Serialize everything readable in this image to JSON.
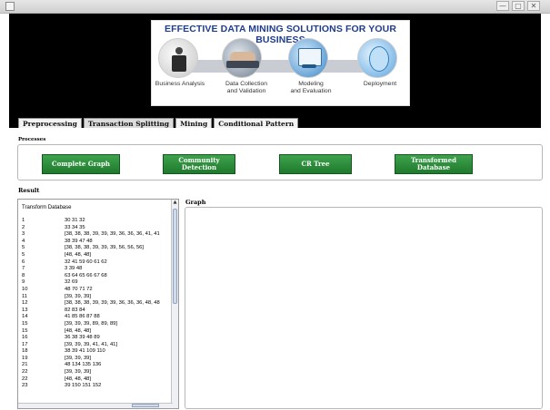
{
  "window": {
    "minimize_icon": "minimize-icon",
    "maximize_icon": "maximize-icon",
    "close_icon": "close-icon",
    "minimize_glyph": "—",
    "maximize_glyph": "▢",
    "close_glyph": "✕"
  },
  "banner": {
    "title": "EFFECTIVE DATA MINING SOLUTIONS FOR YOUR BUSINESS",
    "stages": [
      {
        "line1": "Business Analysis",
        "line2": ""
      },
      {
        "line1": "Data Collection",
        "line2": "and Validation"
      },
      {
        "line1": "Modeling",
        "line2": "and Evaluation"
      },
      {
        "line1": "Deployment",
        "line2": ""
      }
    ]
  },
  "tabs": [
    {
      "label": "Preprocessing",
      "active": false
    },
    {
      "label": "Transaction Splitting",
      "active": true
    },
    {
      "label": "Mining",
      "active": false
    },
    {
      "label": "Conditional Pattern",
      "active": false
    }
  ],
  "processes": {
    "label": "Processes",
    "buttons": [
      {
        "line1": "Complete Graph",
        "line2": ""
      },
      {
        "line1": "Community",
        "line2": "Detection"
      },
      {
        "line1": "CR Tree",
        "line2": ""
      },
      {
        "line1": "Transformed",
        "line2": "Database"
      }
    ],
    "button_color": "#2e8f3c"
  },
  "result": {
    "label": "Result",
    "list_title": "Transform Database",
    "rows": [
      {
        "n": "1",
        "v": "30 31 32"
      },
      {
        "n": "2",
        "v": "33 34 35"
      },
      {
        "n": "3",
        "v": "[38, 38, 38, 39, 39, 39, 36, 36, 36, 41, 41"
      },
      {
        "n": "4",
        "v": "38 39 47 48"
      },
      {
        "n": "5",
        "v": "[38, 38, 38, 39, 39, 39, 56, 56, 56]"
      },
      {
        "n": "5",
        "v": "[48, 48, 48]"
      },
      {
        "n": "6",
        "v": "32 41 59 60 61 62"
      },
      {
        "n": "7",
        "v": "3 39 48"
      },
      {
        "n": "8",
        "v": "63 64 65 66 67 68"
      },
      {
        "n": "9",
        "v": "32 69"
      },
      {
        "n": "10",
        "v": "48 70 71 72"
      },
      {
        "n": "11",
        "v": "[39, 39, 39]"
      },
      {
        "n": "12",
        "v": "[38, 38, 38, 39, 39, 39, 36, 36, 36, 48, 48"
      },
      {
        "n": "13",
        "v": "82 83 84"
      },
      {
        "n": "14",
        "v": "41 85 86 87 88"
      },
      {
        "n": "15",
        "v": "[39, 39, 39, 89, 89, 89]"
      },
      {
        "n": "15",
        "v": "[48, 48, 48]"
      },
      {
        "n": "16",
        "v": "36 38 39 48 89"
      },
      {
        "n": "17",
        "v": "[39, 39, 39, 41, 41, 41]"
      },
      {
        "n": "18",
        "v": "38 39 41 109 110"
      },
      {
        "n": "19",
        "v": "[39, 39, 39]"
      },
      {
        "n": "21",
        "v": "48 134 135 136"
      },
      {
        "n": "22",
        "v": "[39, 39, 39]"
      },
      {
        "n": "22",
        "v": "[48, 48, 48]"
      },
      {
        "n": "23",
        "v": "39 150 151 152"
      }
    ]
  },
  "graph": {
    "label": "Graph"
  }
}
